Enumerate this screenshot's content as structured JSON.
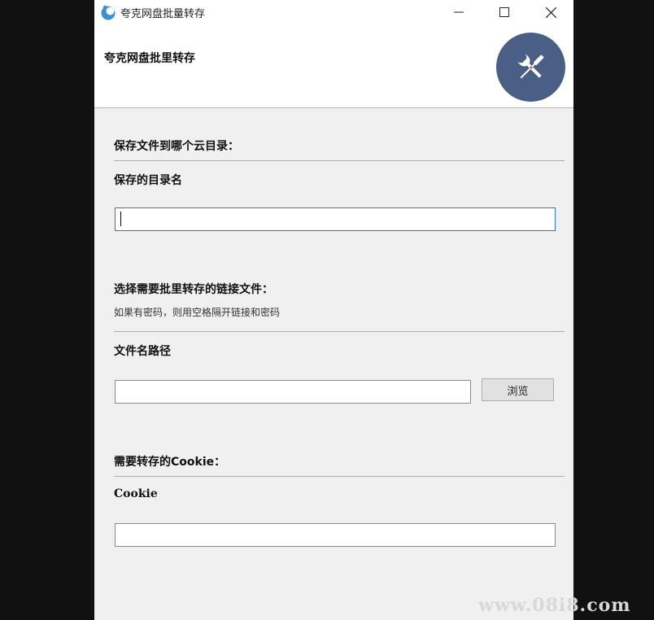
{
  "window": {
    "title": "夸克网盘批量转存",
    "controls": {
      "minimize_icon": "minimize-icon",
      "maximize_icon": "maximize-icon",
      "close_icon": "close-icon"
    }
  },
  "header": {
    "title": "夸克网盘批里转存",
    "badge_icon": "tools-icon",
    "badge_color": "#4a5f86"
  },
  "save_section": {
    "title": "保存文件到哪个云目录：",
    "field_label": "保存的目录名",
    "input_value": "",
    "input_placeholder": ""
  },
  "link_section": {
    "title": "选择需要批里转存的链接文件：",
    "subtitle": "如果有密码，则用空格隔开链接和密码",
    "field_label": "文件名路径",
    "input_value": "",
    "input_placeholder": "",
    "browse_label": "浏览"
  },
  "cookie_section": {
    "title": "需要转存的Cookie：",
    "field_label": "Cookie",
    "input_value": "",
    "input_placeholder": ""
  },
  "watermark": "www.08i8.com",
  "colors": {
    "background": "#111111",
    "window": "#f0f0f0",
    "focus_border": "#2f74c6"
  }
}
